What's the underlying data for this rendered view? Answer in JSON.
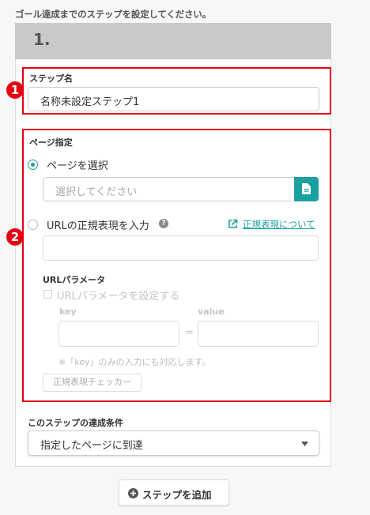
{
  "instruction": "ゴール達成までのステップを設定してください。",
  "step": {
    "number": "1.",
    "name_label": "ステップ名",
    "name_value": "名称未設定ステップ1"
  },
  "markers": {
    "one": "1",
    "two": "2"
  },
  "page_spec": {
    "label": "ページ指定",
    "option_select": "ページを選択",
    "select_placeholder": "選択してください",
    "option_regex": "URLの正規表現を入力",
    "help_glyph": "?",
    "regex_link": "正規表現について",
    "url_params_heading": "URLパラメータ",
    "url_params_checkbox": "URLパラメータを設定する",
    "key_label": "key",
    "equals": "=",
    "value_label": "value",
    "note": "※「key」のみの入力にも対応します。",
    "checker_button": "正規表現チェッカー"
  },
  "condition": {
    "label": "このステップの達成条件",
    "selected": "指定したページに到達"
  },
  "add_step_button": "ステップを追加",
  "colors": {
    "accent": "#1aa0a0",
    "highlight": "#e60012",
    "header": "#c9c9c9"
  }
}
